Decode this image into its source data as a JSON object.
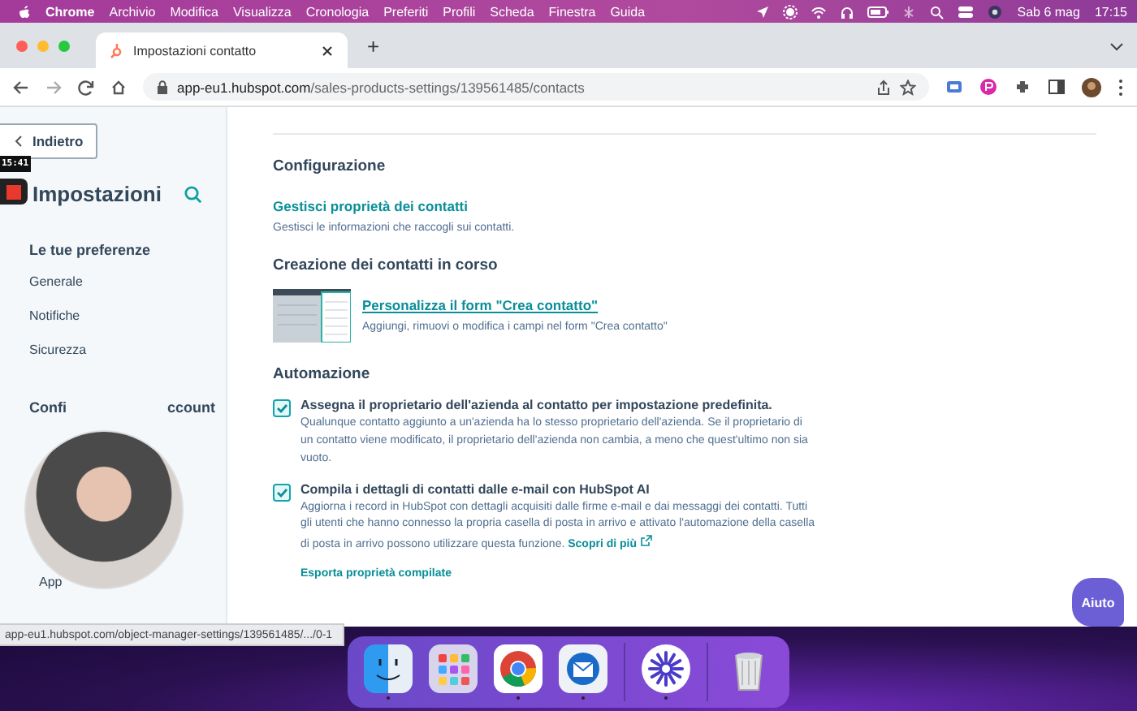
{
  "menubar": {
    "items": [
      "Chrome",
      "Archivio",
      "Modifica",
      "Visualizza",
      "Cronologia",
      "Preferiti",
      "Profili",
      "Scheda",
      "Finestra",
      "Guida"
    ],
    "date": "Sab 6 mag",
    "time": "17:15"
  },
  "browser": {
    "tabs": [
      {
        "title": "Impostazioni contatto",
        "selected": true
      }
    ],
    "new_tab": "+",
    "url_host": "app-eu1.hubspot.com",
    "url_path": "/sales-products-settings/139561485/contacts"
  },
  "recorder": {
    "time": "15:41"
  },
  "sidebar": {
    "back": "Indietro",
    "title": "Impostazioni",
    "sections": [
      {
        "heading_parts": [
          "Le tue preferenze"
        ],
        "items": [
          "Generale",
          "Notifiche",
          "Sicurezza"
        ]
      },
      {
        "heading_parts": [
          "Confi",
          "ccount"
        ],
        "items": [
          "App"
        ]
      }
    ]
  },
  "main": {
    "sections": [
      {
        "kind": "link",
        "heading": "Configurazione",
        "link": "Gestisci proprietà dei contatti",
        "description": "Gestisci le informazioni che raccogli sui contatti."
      },
      {
        "kind": "preview",
        "heading": "Creazione dei contatti in corso",
        "link": "Personalizza il form \"Crea contatto\"",
        "description": "Aggiungi, rimuovi o modifica i campi nel form \"Crea contatto\""
      },
      {
        "kind": "checks",
        "heading": "Automazione",
        "options": [
          {
            "label": "Assegna il proprietario dell'azienda al contatto per impostazione predefinita.",
            "checked": true,
            "description": "Qualunque contatto aggiunto a un'azienda ha lo stesso proprietario dell'azienda. Se il proprietario di un contatto viene modificato, il proprietario dell'azienda non cambia, a meno che quest'ultimo non sia vuoto."
          },
          {
            "label": "Compila i dettagli di contatti dalle e-mail con HubSpot AI",
            "checked": true,
            "description": "Aggiorna i record in HubSpot con dettagli acquisiti dalle firme e-mail e dai messaggi dei contatti. Tutti gli utenti che hanno connesso la propria casella di posta in arrivo e attivato l'automazione della casella di posta in arrivo possono utilizzare questa funzione.",
            "inline_link": "Scopri di più",
            "extra_link": "Esporta proprietà compilate"
          }
        ]
      }
    ]
  },
  "help": "Aiuto",
  "status_url": "app-eu1.hubspot.com/object-manager-settings/139561485/.../0-1",
  "dock": [
    {
      "kind": "finder",
      "running": true
    },
    {
      "kind": "launchpad",
      "running": false
    },
    {
      "kind": "chrome",
      "running": true
    },
    {
      "kind": "mail",
      "running": true
    },
    {
      "kind": "separator"
    },
    {
      "kind": "sunburst",
      "running": true
    },
    {
      "kind": "separator"
    },
    {
      "kind": "trash",
      "running": false
    }
  ]
}
